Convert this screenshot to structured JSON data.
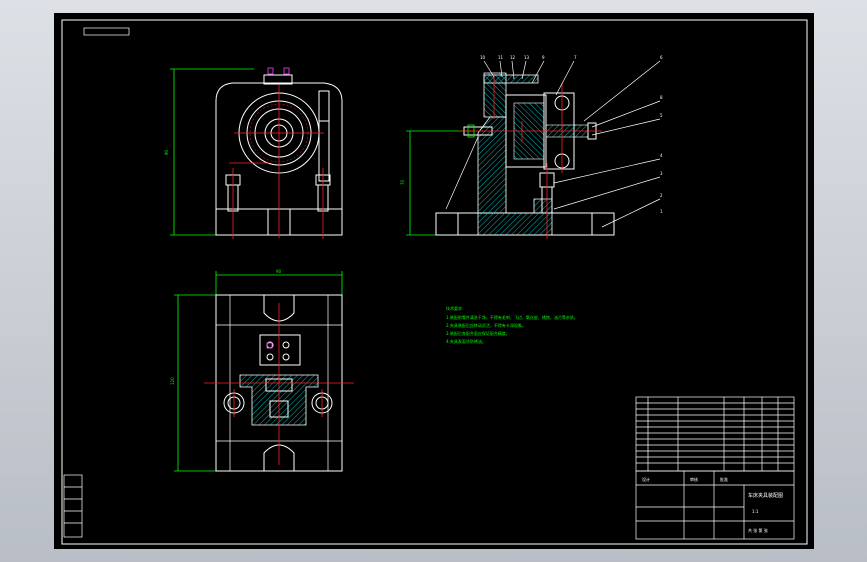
{
  "balloons": [
    "10",
    "11",
    "12",
    "13",
    "9",
    "7",
    "6",
    "8",
    "5",
    "4",
    "3",
    "2",
    "1"
  ],
  "tech_notes": [
    "技术要求",
    "1.装配前零件清洗干净，不得有毛刺、飞边、氧化皮、锈蚀、油污等杂质。",
    "2.夹具装配后应转动灵活，不得有卡滞现象。",
    "3.装配后各配合面应保证配合精度。",
    "4.夹具表面涂防锈油。"
  ],
  "title_block": {
    "drawing_name": "车床夹具装配图",
    "scale": "1:1",
    "designer": "设计",
    "checker": "审核",
    "approver": "批准",
    "sheet": "共 张 第 张"
  },
  "colors": {
    "outline": "#ffffff",
    "dimension": "#00ff00",
    "centerline": "#ff2020",
    "hatch": "#00e0e0",
    "background": "#000000"
  }
}
